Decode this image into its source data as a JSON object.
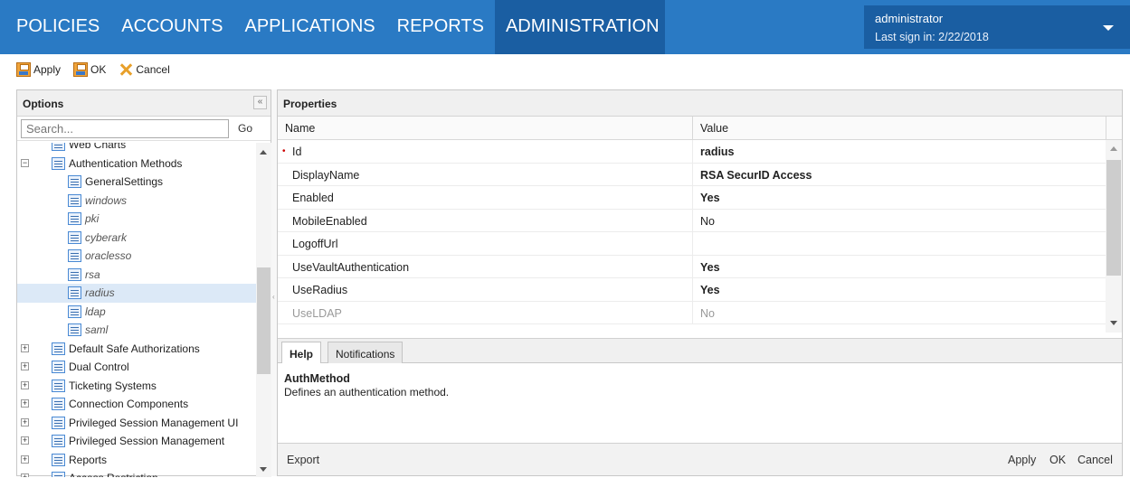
{
  "nav": {
    "items": [
      "POLICIES",
      "ACCOUNTS",
      "APPLICATIONS",
      "REPORTS",
      "ADMINISTRATION"
    ],
    "active": "ADMINISTRATION"
  },
  "user": {
    "name": "administrator",
    "last_sign_in": "Last sign in:  2/22/2018"
  },
  "toolbar": {
    "apply": "Apply",
    "ok": "OK",
    "cancel": "Cancel"
  },
  "options": {
    "title": "Options",
    "collapse": "«",
    "search_placeholder": "Search...",
    "go": "Go",
    "tree": [
      {
        "label": "Web Charts",
        "level": 1,
        "italic": false
      },
      {
        "label": "Authentication Methods",
        "level": 1,
        "italic": false,
        "expander": "−"
      },
      {
        "label": "GeneralSettings",
        "level": 2,
        "italic": false
      },
      {
        "label": "windows",
        "level": 2,
        "italic": true
      },
      {
        "label": "pki",
        "level": 2,
        "italic": true
      },
      {
        "label": "cyberark",
        "level": 2,
        "italic": true
      },
      {
        "label": "oraclesso",
        "level": 2,
        "italic": true
      },
      {
        "label": "rsa",
        "level": 2,
        "italic": true
      },
      {
        "label": "radius",
        "level": 2,
        "italic": true,
        "selected": true
      },
      {
        "label": "ldap",
        "level": 2,
        "italic": true
      },
      {
        "label": "saml",
        "level": 2,
        "italic": true
      },
      {
        "label": "Default Safe Authorizations",
        "level": 1,
        "italic": false,
        "expander": "+"
      },
      {
        "label": "Dual Control",
        "level": 1,
        "italic": false,
        "expander": "+"
      },
      {
        "label": "Ticketing Systems",
        "level": 1,
        "italic": false,
        "expander": "+"
      },
      {
        "label": "Connection Components",
        "level": 1,
        "italic": false,
        "expander": "+"
      },
      {
        "label": "Privileged Session Management UI",
        "level": 1,
        "italic": false,
        "expander": "+"
      },
      {
        "label": "Privileged Session Management",
        "level": 1,
        "italic": false,
        "expander": "+"
      },
      {
        "label": "Reports",
        "level": 1,
        "italic": false,
        "expander": "+"
      },
      {
        "label": "Access Restriction",
        "level": 1,
        "italic": false,
        "expander": "+"
      }
    ]
  },
  "properties": {
    "title": "Properties",
    "col_name": "Name",
    "col_value": "Value",
    "rows": [
      {
        "name": "Id",
        "value": "radius",
        "bold": true,
        "required": "•"
      },
      {
        "name": "DisplayName",
        "value": "RSA SecurID Access",
        "bold": true
      },
      {
        "name": "Enabled",
        "value": "Yes",
        "bold": true
      },
      {
        "name": "MobileEnabled",
        "value": "No",
        "bold": false
      },
      {
        "name": "LogoffUrl",
        "value": "",
        "bold": false
      },
      {
        "name": "UseVaultAuthentication",
        "value": "Yes",
        "bold": true
      },
      {
        "name": "UseRadius",
        "value": "Yes",
        "bold": true
      },
      {
        "name": "UseLDAP",
        "value": "No",
        "bold": false,
        "dim": true
      }
    ]
  },
  "help": {
    "tabs": [
      "Help",
      "Notifications"
    ],
    "heading": "AuthMethod",
    "description": "Defines an authentication method."
  },
  "footer": {
    "export": "Export",
    "apply": "Apply",
    "ok": "OK",
    "cancel": "Cancel"
  },
  "colors": {
    "nav_bg": "#2a7ac4",
    "nav_active": "#1a5ea2",
    "selected_row": "#dce9f7"
  }
}
